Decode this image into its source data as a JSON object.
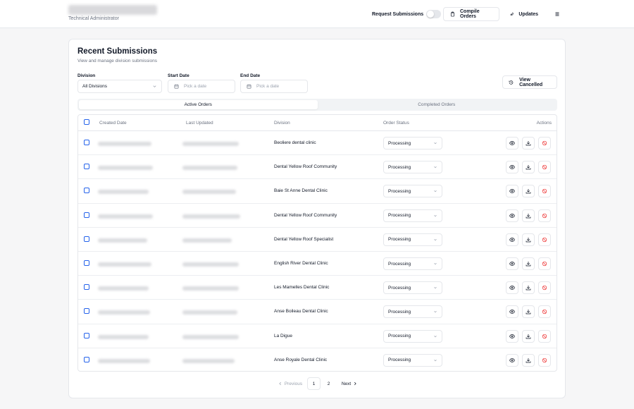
{
  "header": {
    "role": "Technical Administrator",
    "request_submissions_label": "Request Submissions",
    "request_submissions_on": false,
    "compile_orders_label": "Compile Orders",
    "updates_label": "Updates"
  },
  "card": {
    "title": "Recent Submissions",
    "subtitle": "View and manage division submissions"
  },
  "filters": {
    "division_label": "Division",
    "division_value": "All Divisions",
    "start_date_label": "Start Date",
    "start_date_placeholder": "Pick a date",
    "end_date_label": "End Date",
    "end_date_placeholder": "Pick a date",
    "view_cancelled_label": "View Cancelled"
  },
  "tabs": [
    {
      "label": "Active Orders",
      "active": true
    },
    {
      "label": "Completed Orders",
      "active": false
    }
  ],
  "table": {
    "columns": [
      "Created Date",
      "Last Updated",
      "Division",
      "Order Status",
      "Actions"
    ],
    "rows": [
      {
        "division": "Beoliere dental clinic",
        "status": "Processing"
      },
      {
        "division": "Dental Yellow Roof Community",
        "status": "Processing"
      },
      {
        "division": "Baie St Anne Dental Clinic",
        "status": "Processing"
      },
      {
        "division": "Dental Yellow Roof Community",
        "status": "Processing"
      },
      {
        "division": "Dental Yellow Roof Specialist",
        "status": "Processing"
      },
      {
        "division": "English River Dental Clinic",
        "status": "Processing"
      },
      {
        "division": "Les Mamelles Dental Clinic",
        "status": "Processing"
      },
      {
        "division": "Anse Boileau Dental Clinic",
        "status": "Processing"
      },
      {
        "division": "La Digue",
        "status": "Processing"
      },
      {
        "division": "Anse Royale Dental Clinic",
        "status": "Processing"
      }
    ]
  },
  "pagination": {
    "previous_label": "Previous",
    "pages": [
      "1",
      "2"
    ],
    "current_page": "1",
    "next_label": "Next"
  },
  "colors": {
    "checkbox_accent": "#2563eb",
    "cancel_action": "#ef4444",
    "muted_text": "#6b7280"
  },
  "icons": {
    "compile": "clipboard-icon",
    "updates": "rocket-icon",
    "menu": "hamburger-menu-icon",
    "view_cancelled": "history-icon",
    "date": "calendar-icon",
    "view": "eye-icon",
    "download": "download-icon",
    "cancel": "ban-icon"
  }
}
